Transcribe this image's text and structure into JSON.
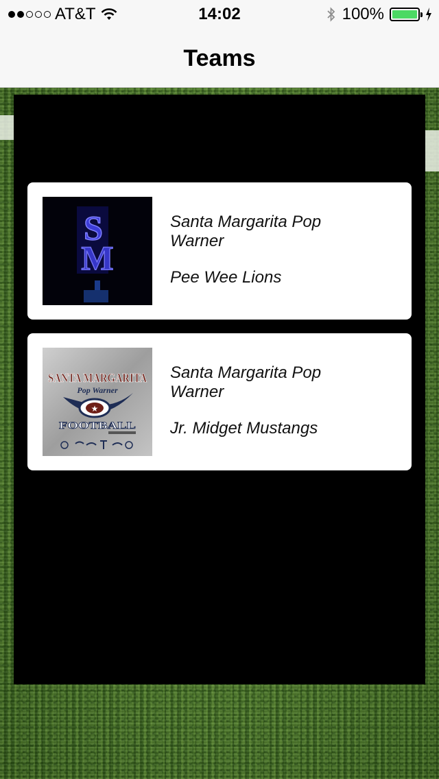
{
  "status_bar": {
    "carrier": "AT&T",
    "time": "14:02",
    "battery_percent": "100%",
    "signal_bars_filled": 2,
    "signal_bars_total": 5
  },
  "nav": {
    "title": "Teams"
  },
  "teams": [
    {
      "organization": "Santa Margarita Pop Warner",
      "name": "Pee Wee Lions",
      "logo": {
        "text": "SM",
        "icon": "sm-monogram-logo"
      }
    },
    {
      "organization": "Santa Margarita Pop Warner",
      "name": "Jr. Midget Mustangs",
      "logo": {
        "line1": "SANTA MARGARITA",
        "line2": "Pop Warner",
        "line3": "FOOTBALL",
        "icon": "pop-warner-football-logo"
      }
    }
  ],
  "colors": {
    "battery": "#4cd964",
    "panel": "#000000",
    "card": "#ffffff"
  }
}
